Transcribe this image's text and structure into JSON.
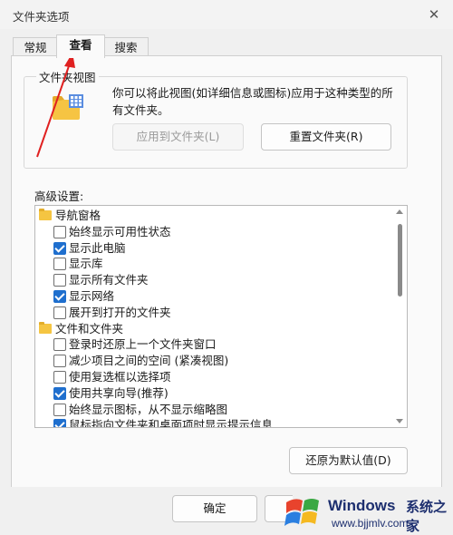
{
  "dialog": {
    "title": "文件夹选项",
    "close": "✕"
  },
  "tabs": [
    {
      "label": "常规"
    },
    {
      "label": "查看"
    },
    {
      "label": "搜索"
    }
  ],
  "folder_views": {
    "group_label": "文件夹视图",
    "description": "你可以将此视图(如详细信息或图标)应用于这种类型的所有文件夹。",
    "apply_button": "应用到文件夹(L)",
    "reset_button": "重置文件夹(R)"
  },
  "advanced": {
    "label": "高级设置:",
    "items": [
      {
        "type": "group",
        "label": "导航窗格",
        "icon": "navigation-pane-icon"
      },
      {
        "type": "checkbox",
        "label": "始终显示可用性状态",
        "checked": false
      },
      {
        "type": "checkbox",
        "label": "显示此电脑",
        "checked": true
      },
      {
        "type": "checkbox",
        "label": "显示库",
        "checked": false
      },
      {
        "type": "checkbox",
        "label": "显示所有文件夹",
        "checked": false
      },
      {
        "type": "checkbox",
        "label": "显示网络",
        "checked": true
      },
      {
        "type": "checkbox",
        "label": "展开到打开的文件夹",
        "checked": false
      },
      {
        "type": "group",
        "label": "文件和文件夹",
        "icon": "folder-icon"
      },
      {
        "type": "checkbox",
        "label": "登录时还原上一个文件夹窗口",
        "checked": false
      },
      {
        "type": "checkbox",
        "label": "减少项目之间的空间 (紧凑视图)",
        "checked": false
      },
      {
        "type": "checkbox",
        "label": "使用复选框以选择项",
        "checked": false
      },
      {
        "type": "checkbox",
        "label": "使用共享向导(推荐)",
        "checked": true
      },
      {
        "type": "checkbox",
        "label": "始终显示图标，从不显示缩略图",
        "checked": false
      },
      {
        "type": "checkbox",
        "label": "鼠标指向文件夹和桌面项时显示提示信息",
        "checked": true
      }
    ],
    "restore_button": "还原为默认值(D)"
  },
  "footer": {
    "ok_button": "确定"
  },
  "watermark": {
    "brand": "Windows",
    "brand_cn": "系统之家",
    "url": "www.bjjmlv.com"
  },
  "colors": {
    "accent": "#1f6fce",
    "annotation_arrow": "#e02020"
  }
}
